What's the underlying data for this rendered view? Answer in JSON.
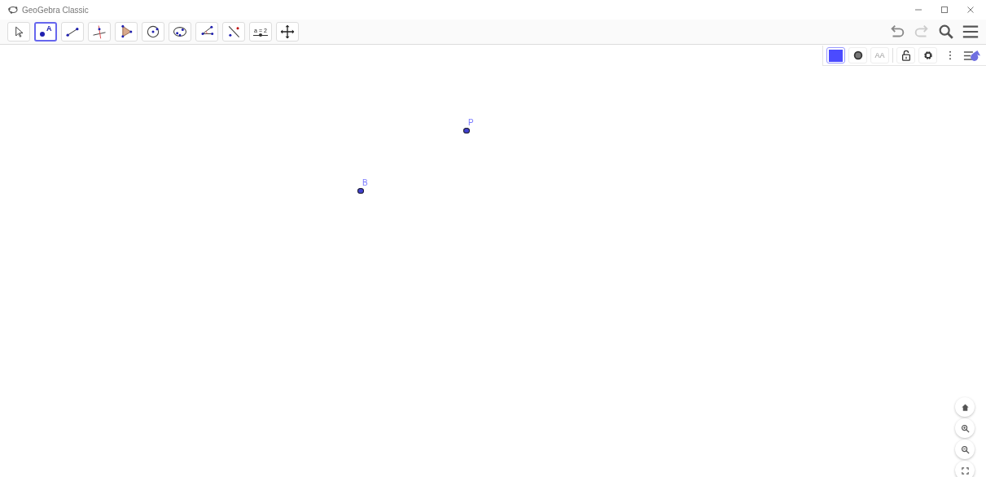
{
  "window": {
    "title": "GeoGebra Classic"
  },
  "toolbar": {
    "tools": [
      {
        "kind": "move",
        "selected": false
      },
      {
        "kind": "point",
        "label": "A",
        "selected": true
      },
      {
        "kind": "line",
        "selected": false
      },
      {
        "kind": "perpendicular",
        "selected": false
      },
      {
        "kind": "polygon",
        "selected": false
      },
      {
        "kind": "circle",
        "selected": false
      },
      {
        "kind": "ellipse",
        "selected": false
      },
      {
        "kind": "angle",
        "selected": false
      },
      {
        "kind": "reflect",
        "selected": false
      },
      {
        "kind": "slider",
        "label": "a = 2",
        "selected": false
      },
      {
        "kind": "pan",
        "selected": false
      }
    ]
  },
  "style_bar": {
    "color": "#4b4bff",
    "text_size_label": "AA"
  },
  "points": [
    {
      "name": "P",
      "color": "#4040d0"
    },
    {
      "name": "B",
      "color": "#4040d0"
    }
  ]
}
